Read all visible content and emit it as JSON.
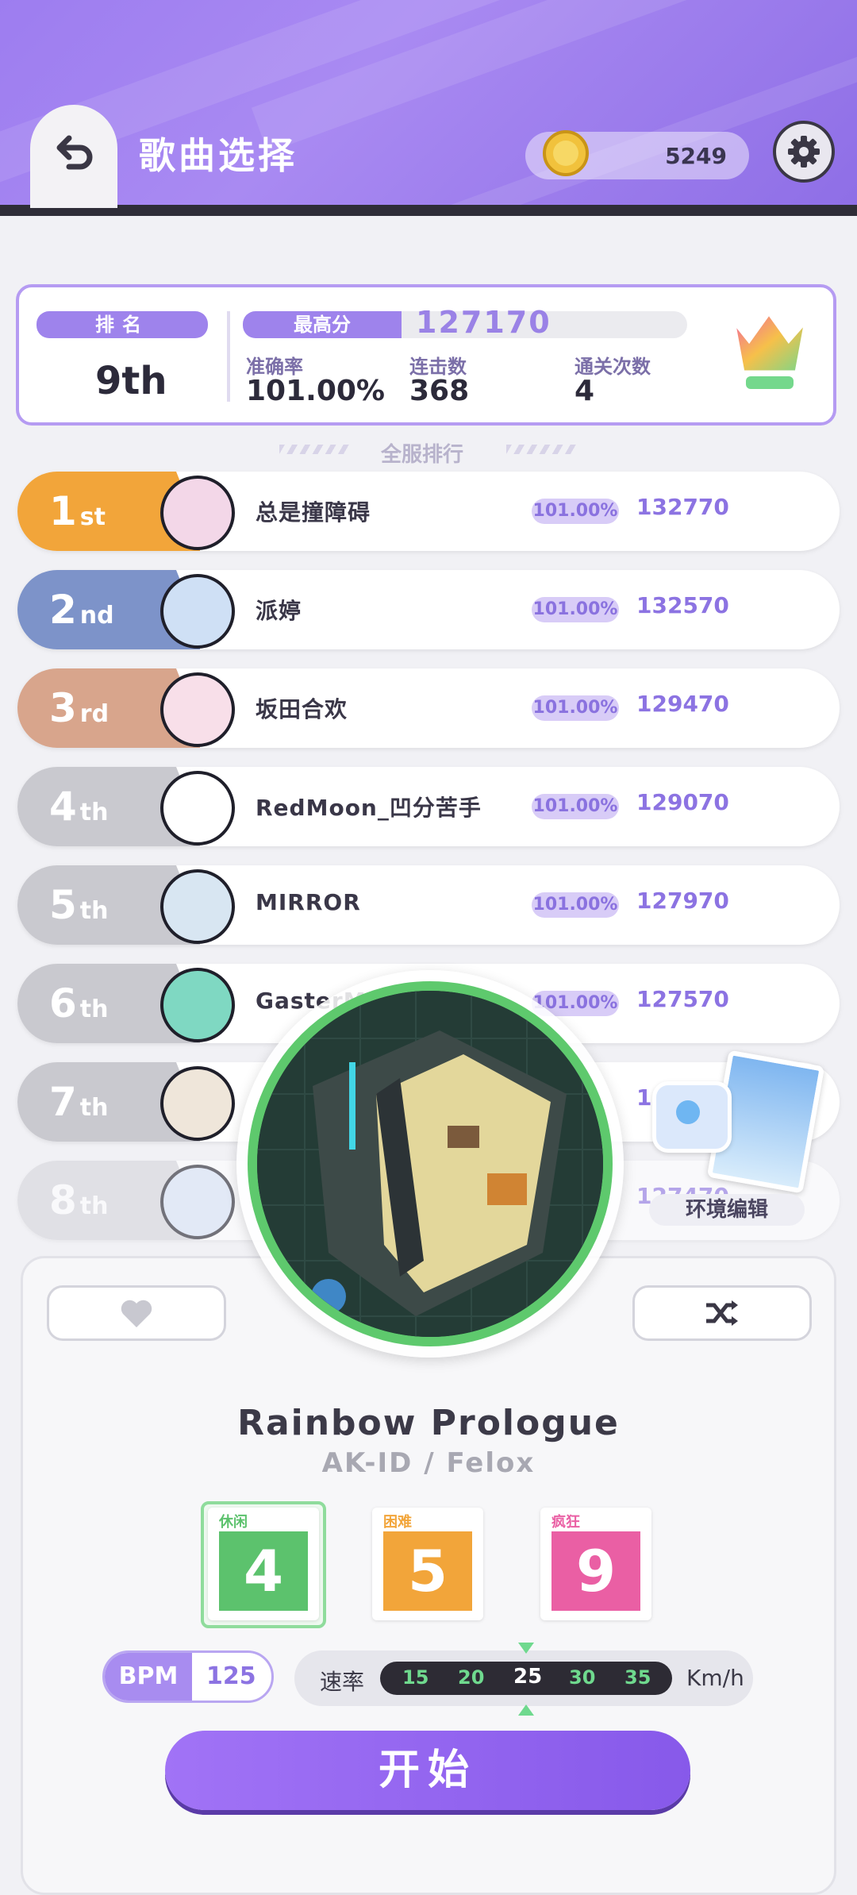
{
  "header": {
    "title": "歌曲选择",
    "coins": "5249"
  },
  "my_score": {
    "rank_label": "排名",
    "rank_value": "9th",
    "best_label": "最高分",
    "best_value": "127170",
    "accuracy_label": "准确率",
    "accuracy_value": "101.00%",
    "combo_label": "连击数",
    "combo_value": "368",
    "clears_label": "通关次数",
    "clears_value": "4"
  },
  "global_rank_label": "全服排行",
  "leaderboard": [
    {
      "num": "1",
      "suffix": "st",
      "name": "总是撞障碍",
      "acc": "101.00%",
      "score": "132770",
      "color": "#f2a53a"
    },
    {
      "num": "2",
      "suffix": "nd",
      "name": "派婷",
      "acc": "101.00%",
      "score": "132570",
      "color": "#7d93c9"
    },
    {
      "num": "3",
      "suffix": "rd",
      "name": "坂田合欢",
      "acc": "101.00%",
      "score": "129470",
      "color": "#d8a58c"
    },
    {
      "num": "4",
      "suffix": "th",
      "name": "RedMoon_凹分苦手",
      "acc": "101.00%",
      "score": "129070",
      "color": "#c9c9cf"
    },
    {
      "num": "5",
      "suffix": "th",
      "name": "MIRROR",
      "acc": "101.00%",
      "score": "127970",
      "color": "#c9c9cf"
    },
    {
      "num": "6",
      "suffix": "th",
      "name": "GasterM",
      "acc": "101.00%",
      "score": "127570",
      "color": "#c9c9cf"
    },
    {
      "num": "7",
      "suffix": "th",
      "name": "",
      "acc": "",
      "score": "1",
      "color": "#c9c9cf"
    },
    {
      "num": "8",
      "suffix": "th",
      "name": "",
      "acc": "",
      "score": "127470",
      "color": "#d6d6dc"
    }
  ],
  "env_edit_label": "环境编辑",
  "song": {
    "title": "Rainbow Prologue",
    "artist": "AK-ID / Felox",
    "bpm_label": "BPM",
    "bpm": "125"
  },
  "difficulties": [
    {
      "label": "休闲",
      "level": "4",
      "color": "#5cc26d"
    },
    {
      "label": "困难",
      "level": "5",
      "color": "#f2a53a"
    },
    {
      "label": "疯狂",
      "level": "9",
      "color": "#ea5fa4"
    }
  ],
  "speed": {
    "label": "速率",
    "values": [
      "15",
      "20",
      "25",
      "30",
      "35"
    ],
    "selected": "25",
    "unit": "Km/h"
  },
  "start_label": "开始",
  "icons": [
    "back-arrow-icon",
    "coin-icon",
    "gear-icon",
    "heart-icon",
    "shuffle-icon",
    "trophy-icon"
  ]
}
